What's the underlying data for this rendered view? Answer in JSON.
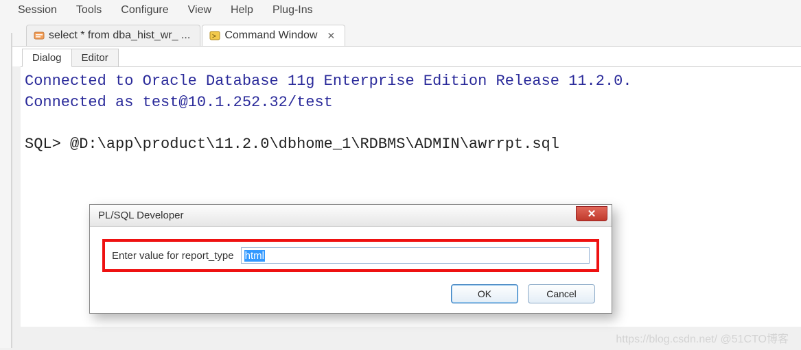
{
  "menu": {
    "items": [
      "Session",
      "Tools",
      "Configure",
      "View",
      "Help",
      "Plug-Ins"
    ]
  },
  "tabs": {
    "doc": [
      {
        "label": "select * from dba_hist_wr_ ...",
        "icon": "sql-icon"
      },
      {
        "label": "Command Window",
        "icon": "cmd-icon"
      }
    ]
  },
  "subtabs": {
    "items": [
      "Dialog",
      "Editor"
    ]
  },
  "console": {
    "line1": "Connected to Oracle Database 11g Enterprise Edition Release 11.2.0.",
    "line2": "Connected as test@10.1.252.32/test",
    "blank": "",
    "sql_prompt": "SQL> ",
    "sql_cmd": "@D:\\app\\product\\11.2.0\\dbhome_1\\RDBMS\\ADMIN\\awrrpt.sql"
  },
  "dialog": {
    "title": "PL/SQL Developer",
    "prompt_label": "Enter value for report_type",
    "input_value": "html",
    "ok_label": "OK",
    "cancel_label": "Cancel",
    "close_glyph": "✕"
  },
  "watermark": "https://blog.csdn.net/ @51CTO博客"
}
